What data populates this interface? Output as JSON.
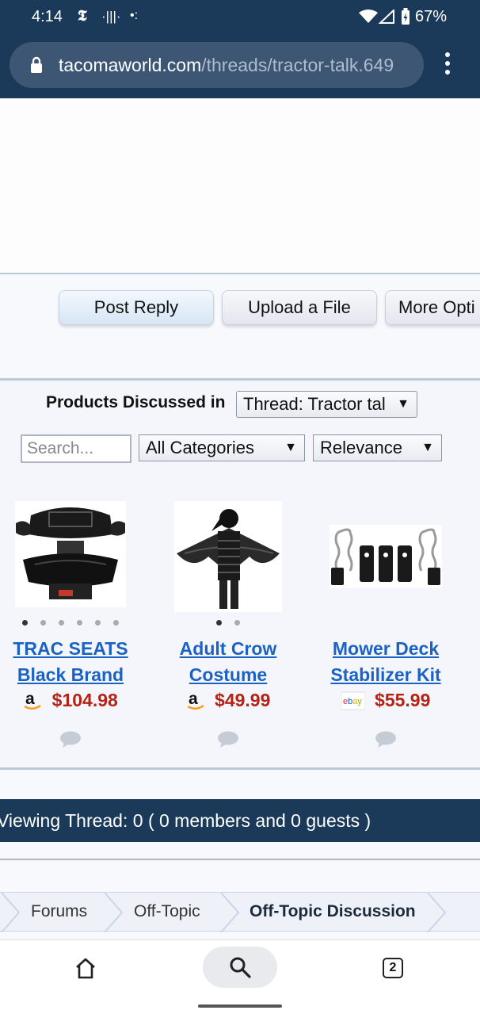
{
  "status_bar": {
    "time": "4:14",
    "battery": "67%"
  },
  "browser": {
    "url_domain": "tacomaworld.com",
    "url_path": "/threads/tractor-talk.649"
  },
  "thread_actions": {
    "post_reply": "Post Reply",
    "upload_file": "Upload a File",
    "more_options": "More Opti"
  },
  "products_panel": {
    "label": "Products Discussed in",
    "thread_select": "Thread: Tractor tal",
    "search_placeholder": "Search...",
    "category_select": "All Categories",
    "sort_select": "Relevance",
    "items": [
      {
        "title": "TRAC SEATS Black Brand",
        "price": "$104.98",
        "store": "amazon",
        "image_count": 6,
        "image_index": 0
      },
      {
        "title": "Adult Crow Costume",
        "price": "$49.99",
        "store": "amazon",
        "image_count": 2,
        "image_index": 0
      },
      {
        "title": "Mower Deck Stabilizer Kit",
        "price": "$55.99",
        "store": "ebay",
        "image_count": 0,
        "image_index": 0
      }
    ]
  },
  "viewing": {
    "text": "Viewing Thread: 0 ( 0 members and 0 guests )"
  },
  "breadcrumb": {
    "items": [
      "Forums",
      "Off-Topic",
      "Off-Topic Discussion"
    ]
  },
  "bottom_nav": {
    "tab_count": "2"
  },
  "colors": {
    "brand_navy": "#1b3a5a",
    "link_blue": "#1a63c4",
    "price_red": "#b52316"
  }
}
